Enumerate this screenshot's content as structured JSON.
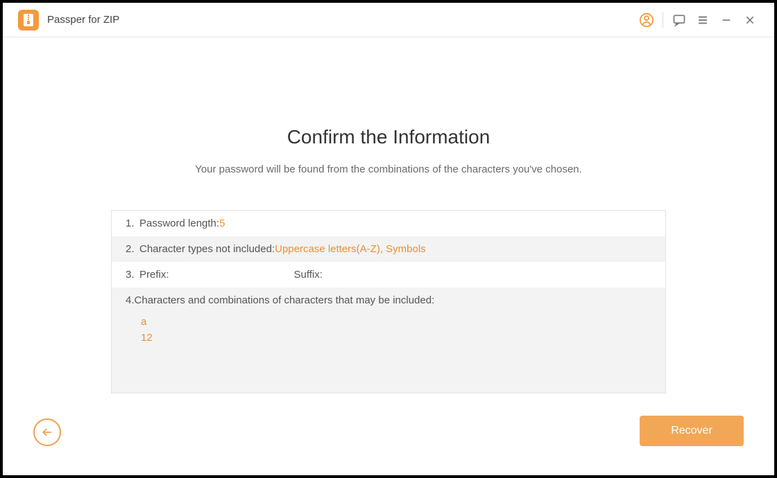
{
  "app": {
    "title": "Passper for ZIP"
  },
  "titlebar": {
    "icons": {
      "user": "user-icon",
      "feedback": "feedback-icon",
      "menu": "menu-icon",
      "minimize": "minimize-icon",
      "close": "close-icon"
    }
  },
  "main": {
    "heading": "Confirm the Information",
    "subheading": "Your password will be found from the combinations of the characters you've chosen."
  },
  "info": {
    "row1_num": "1.",
    "row1_label": "Password length: ",
    "row1_value": "5",
    "row2_num": "2.",
    "row2_label": "Character types not included: ",
    "row2_value": "Uppercase letters(A-Z), Symbols",
    "row3_num": "3.",
    "row3_prefix_label": "Prefix:",
    "row3_prefix_value": "",
    "row3_suffix_label": "Suffix:",
    "row3_suffix_value": "",
    "row4_num": "4.",
    "row4_label": "Characters and combinations of characters that may be included:",
    "row4_items": [
      "a",
      "12"
    ]
  },
  "footer": {
    "back_tooltip": "Back",
    "recover_label": "Recover"
  }
}
